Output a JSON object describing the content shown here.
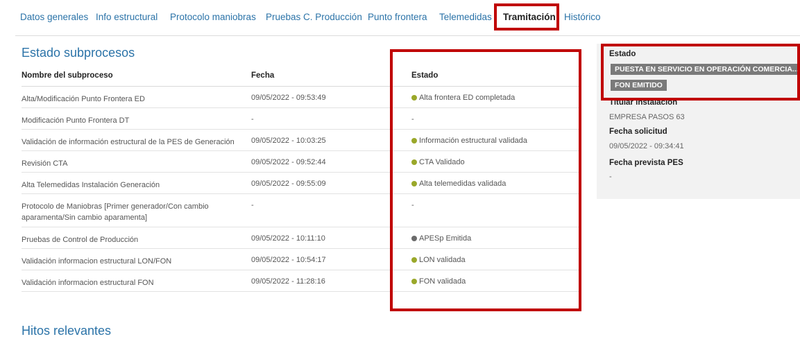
{
  "tabs": [
    {
      "label": "Datos generales"
    },
    {
      "label": "Info estructural"
    },
    {
      "label": "Protocolo maniobras"
    },
    {
      "label": "Pruebas C. Producción"
    },
    {
      "label": "Punto frontera"
    },
    {
      "label": "Telemedidas"
    },
    {
      "label": "Tramitación"
    },
    {
      "label": "Histórico"
    }
  ],
  "active_tab": "Tramitación",
  "main": {
    "title": "Estado subprocesos",
    "headers": {
      "name": "Nombre del subproceso",
      "date": "Fecha",
      "status": "Estado"
    },
    "rows": [
      {
        "name": "Alta/Modificación Punto Frontera ED",
        "date": "09/05/2022 - 09:53:49",
        "status": "Alta frontera ED completada",
        "dot": "olive"
      },
      {
        "name": "Modificación Punto Frontera DT",
        "date": "-",
        "status": "-",
        "dot": ""
      },
      {
        "name": "Validación de información estructural de la PES de Generación",
        "date": "09/05/2022 - 10:03:25",
        "status": "Información estructural validada",
        "dot": "olive"
      },
      {
        "name": "Revisión CTA",
        "date": "09/05/2022 - 09:52:44",
        "status": "CTA Validado",
        "dot": "olive"
      },
      {
        "name": "Alta Telemedidas Instalación Generación",
        "date": "09/05/2022 - 09:55:09",
        "status": "Alta telemedidas validada",
        "dot": "olive"
      },
      {
        "name": "Protocolo de Maniobras [Primer generador/Con cambio aparamenta/Sin cambio aparamenta]",
        "date": "-",
        "status": "-",
        "dot": ""
      },
      {
        "name": "Pruebas de Control de Producción",
        "date": "09/05/2022 - 10:11:10",
        "status": "APESp Emitida",
        "dot": "gray"
      },
      {
        "name": "Validación informacion estructural LON/FON",
        "date": "09/05/2022 - 10:54:17",
        "status": "LON validada",
        "dot": "olive"
      },
      {
        "name": "Validación informacion estructural FON",
        "date": "09/05/2022 - 11:28:16",
        "status": "FON validada",
        "dot": "olive"
      }
    ]
  },
  "hitos": {
    "title": "Hitos relevantes"
  },
  "side": {
    "estado_label": "Estado",
    "badges": [
      "PUESTA EN SERVICIO EN OPERACIÓN COMERCIA...",
      "FON EMITIDO"
    ],
    "titular_label": "Titular instalación",
    "titular_value": "EMPRESA PASOS 63",
    "fecha_solicitud_label": "Fecha solicitud",
    "fecha_solicitud_value": "09/05/2022 - 09:34:41",
    "fecha_prevista_label": "Fecha prevista PES",
    "fecha_prevista_value": "-"
  },
  "colors": {
    "link": "#2b73a8",
    "highlight": "#c00000",
    "dot_olive": "#9aa82a",
    "dot_gray": "#6b6b6b",
    "badge": "#7a7a7a"
  }
}
